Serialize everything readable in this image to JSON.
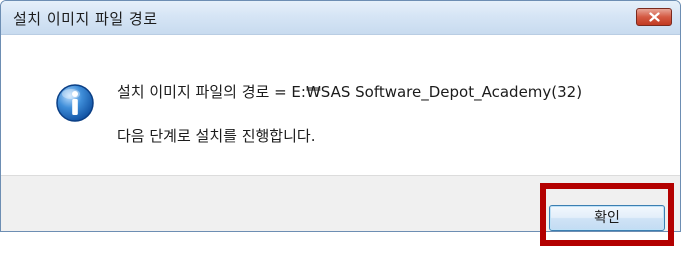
{
  "window": {
    "title": "설치 이미지 파일 경로",
    "close_icon": "close-icon"
  },
  "message": {
    "icon": "info-icon",
    "line1": "설치 이미지 파일의 경로 = E:₩SAS Software_Depot_Academy(32)",
    "line2": "다음 단계로 설치를 진행합니다."
  },
  "buttons": {
    "ok_label": "확인"
  },
  "colors": {
    "highlight_border": "#b30000",
    "close_button": "#c94b33",
    "info_icon": "#1f6fc4"
  }
}
